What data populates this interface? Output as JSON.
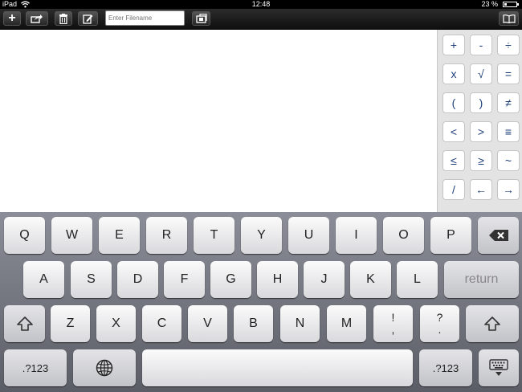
{
  "status": {
    "carrier": "iPad",
    "time": "12:48",
    "battery": "23 %",
    "battery_level": 0.23
  },
  "toolbar": {
    "buttons": [
      "add-icon",
      "share-icon",
      "trash-icon",
      "edit-icon",
      "folder-icon",
      "book-icon"
    ],
    "filename_placeholder": "Enter Filename",
    "add_label": "+"
  },
  "symbols": [
    [
      "+",
      "-",
      "÷"
    ],
    [
      "x",
      "√",
      "="
    ],
    [
      "(",
      ")",
      "≠"
    ],
    [
      "<",
      ">",
      "≡"
    ],
    [
      "≤",
      "≥",
      "~"
    ],
    [
      "/",
      "←",
      "→"
    ]
  ],
  "keyboard": {
    "row1": [
      "Q",
      "W",
      "E",
      "R",
      "T",
      "Y",
      "U",
      "I",
      "O",
      "P"
    ],
    "row2": [
      "A",
      "S",
      "D",
      "F",
      "G",
      "H",
      "J",
      "K",
      "L"
    ],
    "return": "return",
    "row3": [
      "Z",
      "X",
      "C",
      "V",
      "B",
      "N",
      "M"
    ],
    "exclaim": {
      "top": "!",
      "bottom": ","
    },
    "question": {
      "top": "?",
      "bottom": "."
    },
    "numbers": ".?123"
  }
}
